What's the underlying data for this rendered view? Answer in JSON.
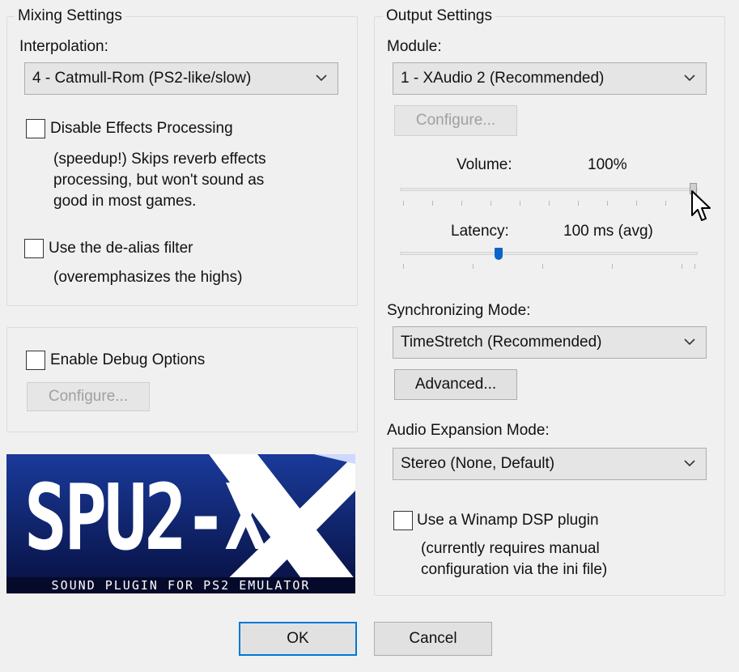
{
  "mixing": {
    "legend": "Mixing Settings",
    "interpolation_label": "Interpolation:",
    "interpolation_value": "4 - Catmull-Rom (PS2-like/slow)",
    "disable_effects_label": "Disable Effects Processing",
    "disable_effects_checked": false,
    "disable_effects_desc_1": "(speedup!) Skips reverb effects",
    "disable_effects_desc_2": "processing, but won't sound as",
    "disable_effects_desc_3": "good in most games.",
    "dealias_label": "Use the de-alias filter",
    "dealias_checked": false,
    "dealias_desc": "(overemphasizes the highs)"
  },
  "debug": {
    "enable_label": "Enable Debug Options",
    "enable_checked": false,
    "configure_label": "Configure..."
  },
  "logo": {
    "text": "SPU2-X",
    "tagline": "SOUND PLUGIN FOR PS2 EMULATOR"
  },
  "output": {
    "legend": "Output Settings",
    "module_label": "Module:",
    "module_value": "1 - XAudio 2 (Recommended)",
    "configure_label": "Configure...",
    "volume_label": "Volume:",
    "volume_value": "100%",
    "volume_fraction": 1.0,
    "latency_label": "Latency:",
    "latency_value": "100 ms (avg)",
    "sync_label": "Synchronizing Mode:",
    "sync_value": "TimeStretch (Recommended)",
    "advanced_label": "Advanced...",
    "expansion_label": "Audio Expansion Mode:",
    "expansion_value": "Stereo (None, Default)",
    "winamp_label": "Use a Winamp DSP plugin",
    "winamp_checked": false,
    "winamp_desc_1": "(currently requires manual",
    "winamp_desc_2": "configuration via the ini file)"
  },
  "footer": {
    "ok_label": "OK",
    "cancel_label": "Cancel"
  }
}
